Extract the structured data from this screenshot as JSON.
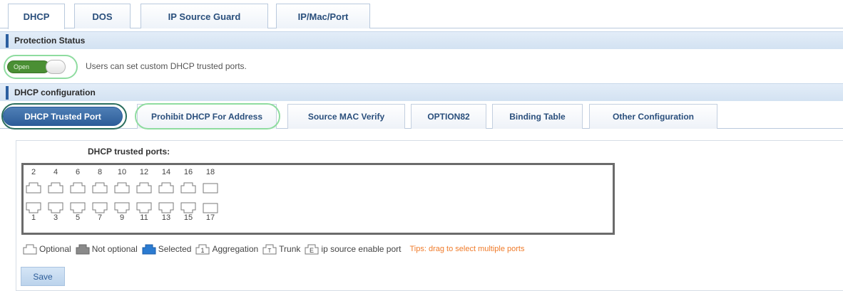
{
  "top_tabs": [
    {
      "label": "DHCP",
      "active": true
    },
    {
      "label": "DOS",
      "active": false
    },
    {
      "label": "IP Source Guard",
      "active": false
    },
    {
      "label": "IP/Mac/Port",
      "active": false
    }
  ],
  "protection": {
    "header": "Protection Status",
    "toggle_label": "Open",
    "toggle_state": "on",
    "description": "Users can set custom DHCP trusted ports."
  },
  "dhcp_config": {
    "header": "DHCP configuration",
    "sub_tabs": [
      {
        "label": "DHCP Trusted Port",
        "active": true
      },
      {
        "label": "Prohibit DHCP For Address",
        "active": false
      },
      {
        "label": "Source MAC Verify",
        "active": false
      },
      {
        "label": "OPTION82",
        "active": false
      },
      {
        "label": "Binding Table",
        "active": false
      },
      {
        "label": "Other Configuration",
        "active": false
      }
    ]
  },
  "trusted_ports": {
    "label": "DHCP trusted ports:",
    "top_row": [
      "2",
      "4",
      "6",
      "8",
      "10",
      "12",
      "14",
      "16",
      "18"
    ],
    "bottom_row": [
      "1",
      "3",
      "5",
      "7",
      "9",
      "11",
      "13",
      "15",
      "17"
    ],
    "fiber_ports": [
      "17",
      "18"
    ]
  },
  "legend": {
    "optional": "Optional",
    "not_optional": "Not optional",
    "selected": "Selected",
    "aggregation": "Aggregation",
    "aggregation_glyph": "1",
    "trunk": "Trunk",
    "trunk_glyph": "T",
    "ip_source": "ip source enable port",
    "ip_source_glyph": "E",
    "tips": "Tips: drag to select multiple ports"
  },
  "save_label": "Save",
  "colors": {
    "accent": "#2c5c98",
    "toggle_on": "#4a8f34",
    "tips": "#f07b2a",
    "highlight_ring": "#8fdca0"
  }
}
